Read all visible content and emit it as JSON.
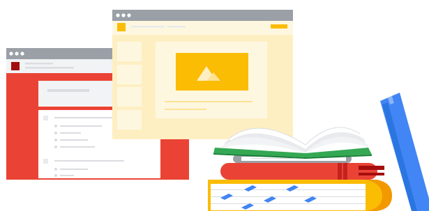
{
  "illustration": {
    "colors": {
      "window_chrome": "#9aa0a6",
      "window_dots": "#ffffff",
      "red": "#ea4335",
      "red_dark": "#a50e0e",
      "yellow": "#fbbc04",
      "yellow_light": "#feefc3",
      "yellow_pale": "#fef7e0",
      "blue": "#4285f4",
      "blue_dark": "#1967d2",
      "green": "#34a853",
      "green_dark": "#188038",
      "gray_light": "#f1f3f4",
      "gray_line": "#dadce0",
      "gray_mid": "#bdc1c6",
      "paper": "#f8f9fa",
      "orange": "#f29900"
    },
    "icons": [
      "browser-window-icon",
      "image-placeholder-icon",
      "mountain-icon",
      "book-stack-icon",
      "open-book-icon"
    ]
  }
}
